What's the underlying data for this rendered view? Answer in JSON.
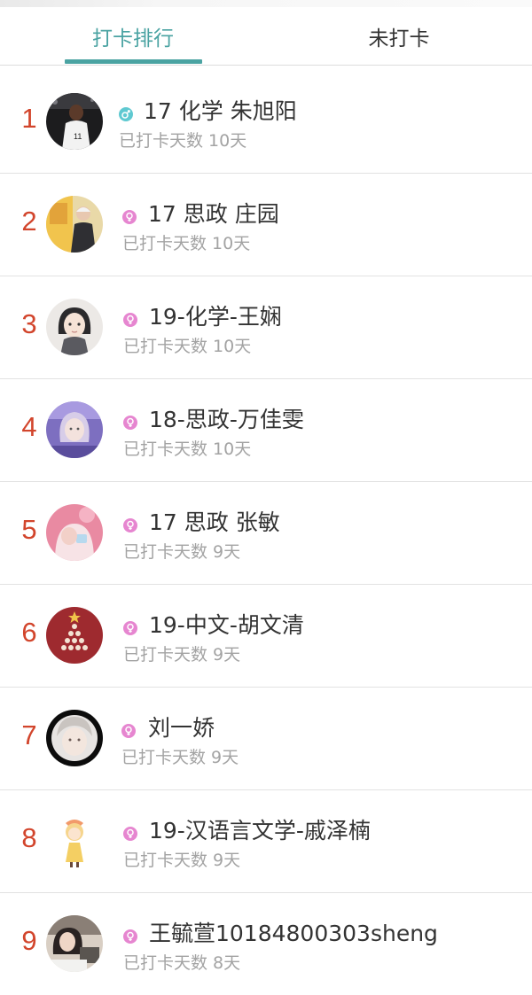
{
  "tabs": [
    {
      "label": "打卡排行",
      "active": true
    },
    {
      "label": "未打卡",
      "active": false
    }
  ],
  "colors": {
    "accent": "#4aa3a2",
    "rank": "#d2452c",
    "female": "#e686d0",
    "male": "#5fc9d1"
  },
  "items": [
    {
      "rank": "1",
      "gender_icon": "male-icon",
      "name": "17 化学 朱旭阳",
      "days": "已打卡天数 10天"
    },
    {
      "rank": "2",
      "gender_icon": "female-icon",
      "name": "17 思政 庄园",
      "days": "已打卡天数 10天"
    },
    {
      "rank": "3",
      "gender_icon": "female-icon",
      "name": "19-化学-王娴",
      "days": "已打卡天数 10天"
    },
    {
      "rank": "4",
      "gender_icon": "female-icon",
      "name": "18-思政-万佳雯",
      "days": "已打卡天数 10天"
    },
    {
      "rank": "5",
      "gender_icon": "female-icon",
      "name": "17 思政 张敏",
      "days": "已打卡天数 9天"
    },
    {
      "rank": "6",
      "gender_icon": "female-icon",
      "name": "19-中文-胡文清",
      "days": "已打卡天数 9天"
    },
    {
      "rank": "7",
      "gender_icon": "female-icon",
      "name": "刘一娇",
      "days": "已打卡天数 9天"
    },
    {
      "rank": "8",
      "gender_icon": "female-icon",
      "name": "19-汉语言文学-戚泽楠",
      "days": "已打卡天数 9天"
    },
    {
      "rank": "9",
      "gender_icon": "female-icon",
      "name": "王毓萱10184800303sheng",
      "days": "已打卡天数 8天"
    }
  ]
}
